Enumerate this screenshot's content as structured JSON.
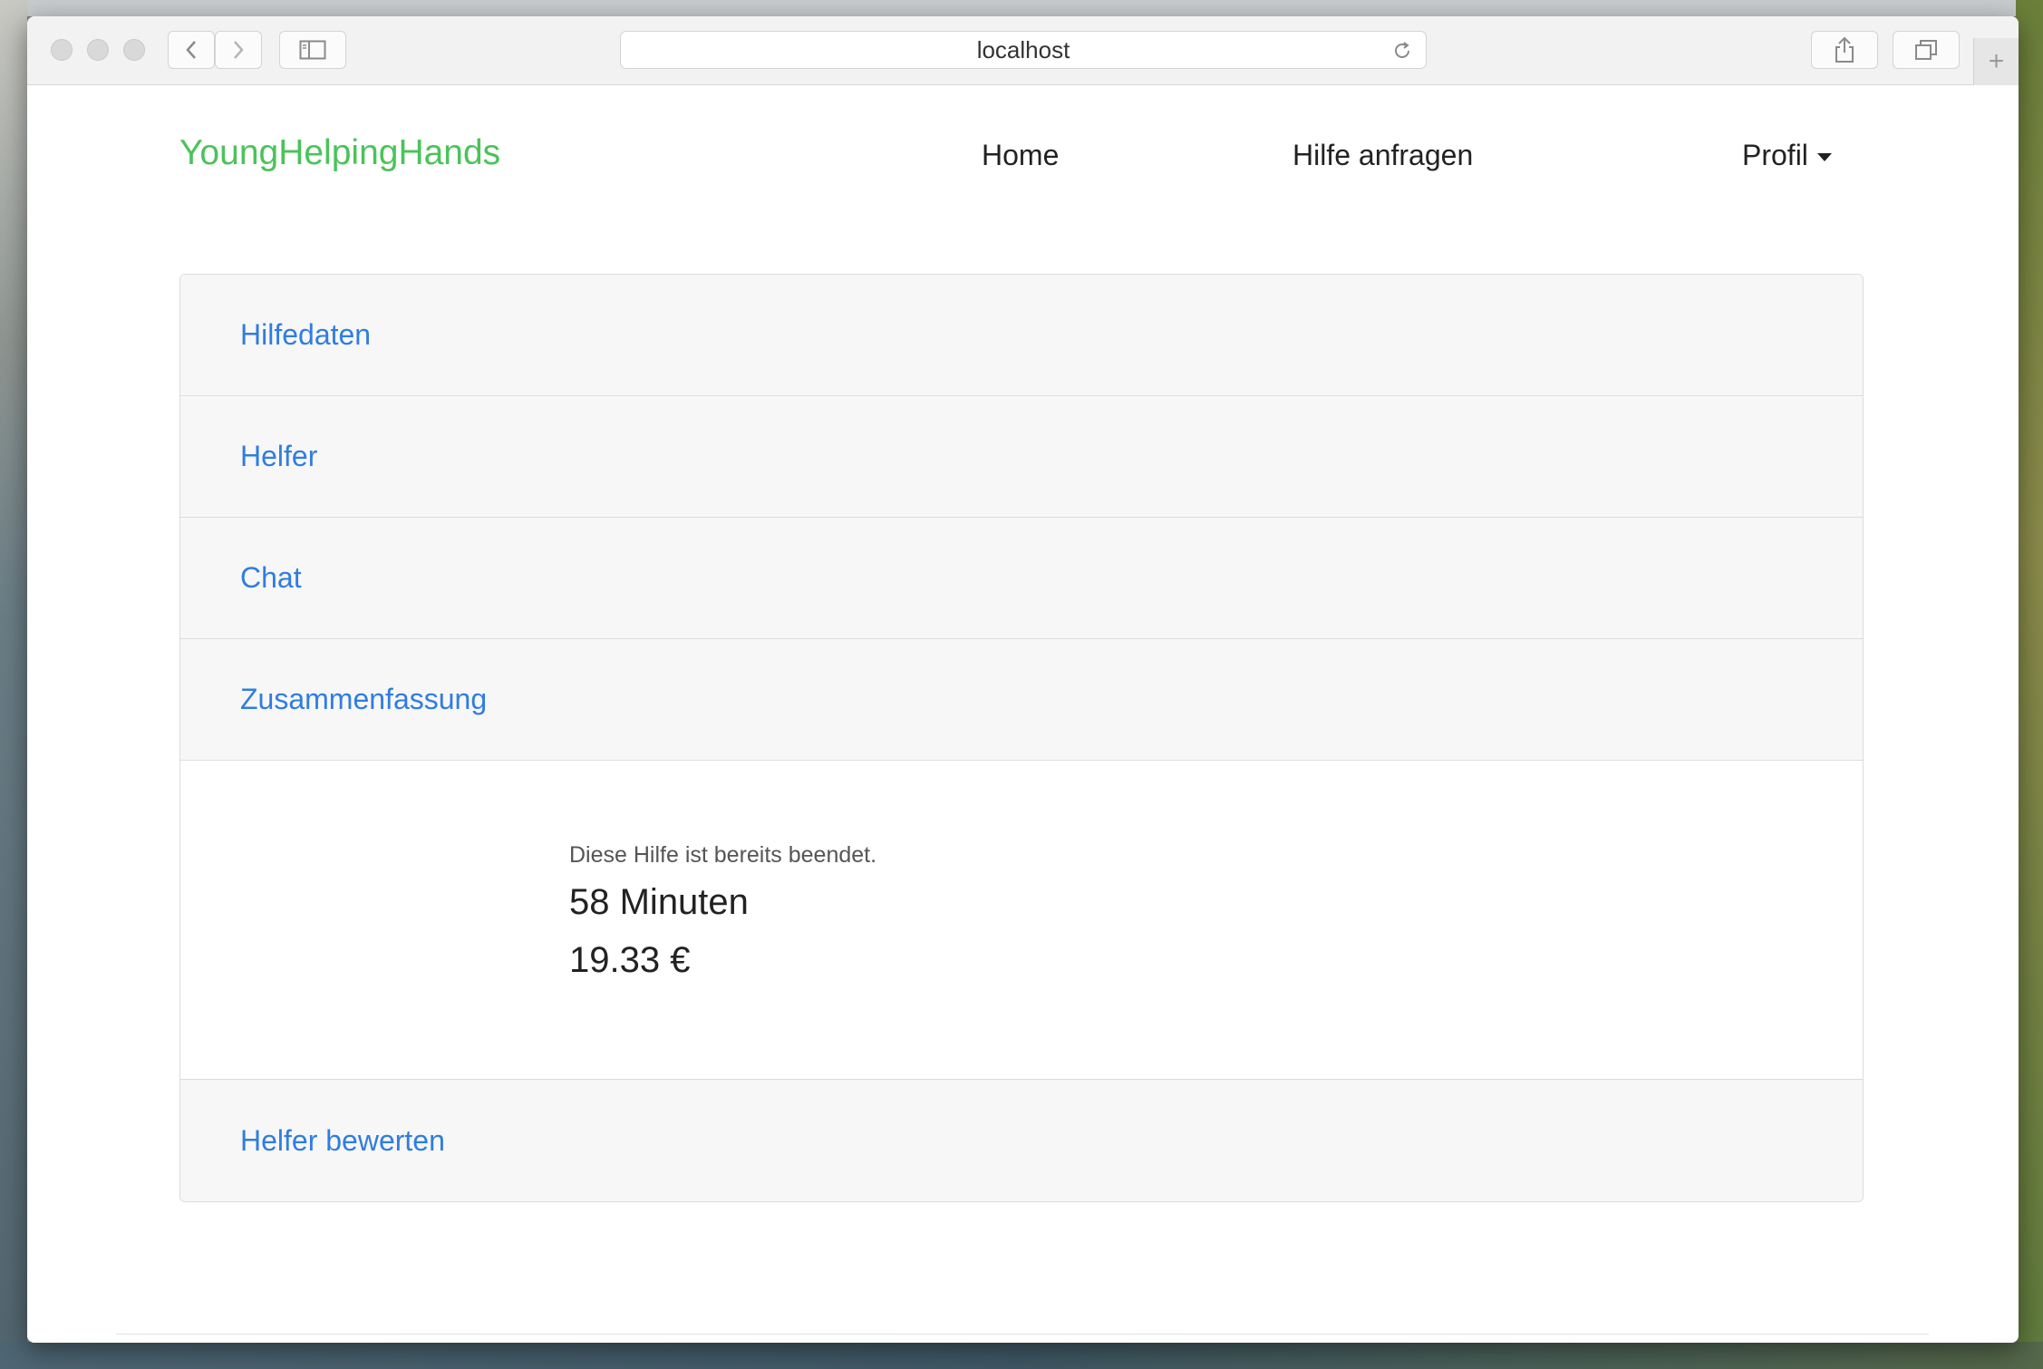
{
  "browser": {
    "url": "localhost",
    "colors": {
      "toolbar": "#f2f2f2"
    }
  },
  "navbar": {
    "brand": "YoungHelpingHands",
    "links": [
      {
        "label": "Home"
      },
      {
        "label": "Hilfe anfragen"
      },
      {
        "label": "Profil"
      }
    ]
  },
  "accordion": {
    "sections": [
      {
        "label": "Hilfedaten"
      },
      {
        "label": "Helfer"
      },
      {
        "label": "Chat"
      },
      {
        "label": "Zusammenfassung"
      }
    ],
    "summary": {
      "status": "Diese Hilfe ist bereits beendet.",
      "duration": "58 Minuten",
      "price": "19.33 €"
    },
    "rate": {
      "label": "Helfer bewerten"
    }
  },
  "colors": {
    "brand": "#4bc35a",
    "link": "#2f7de1"
  }
}
